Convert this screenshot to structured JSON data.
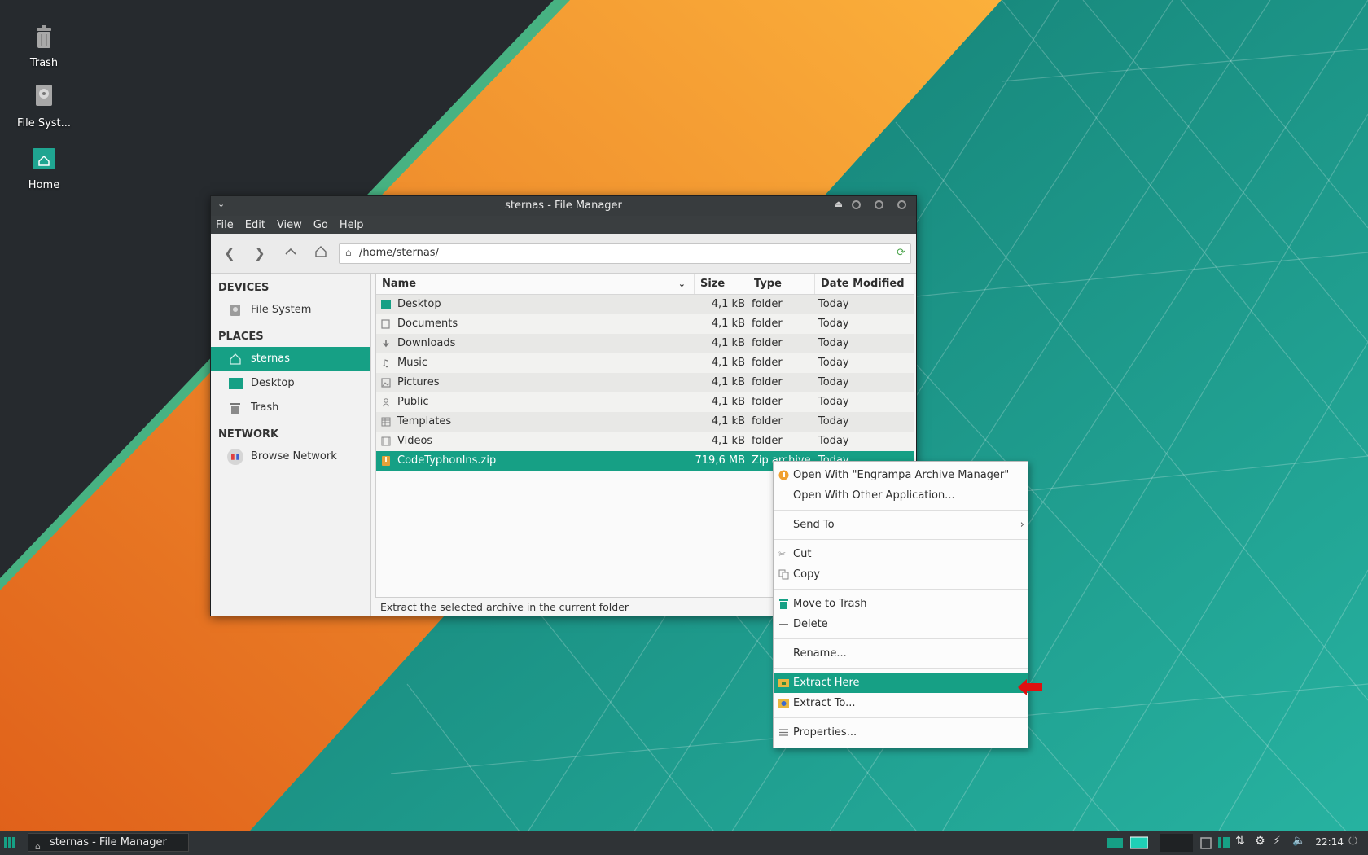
{
  "desktop": {
    "icons": [
      {
        "label": "Trash",
        "icon": "trash-icon"
      },
      {
        "label": "File Syst...",
        "icon": "drive-icon"
      },
      {
        "label": "Home",
        "icon": "home-folder-icon"
      }
    ]
  },
  "window": {
    "title": "sternas - File Manager",
    "menu": [
      "File",
      "Edit",
      "View",
      "Go",
      "Help"
    ],
    "address": "/home/sternas/"
  },
  "sidebar": {
    "devices_header": "DEVICES",
    "devices": [
      {
        "label": "File System",
        "icon": "drive-icon"
      }
    ],
    "places_header": "PLACES",
    "places": [
      {
        "label": "sternas",
        "icon": "home-icon",
        "selected": true
      },
      {
        "label": "Desktop",
        "icon": "desktop-folder-icon"
      },
      {
        "label": "Trash",
        "icon": "trash-icon"
      }
    ],
    "network_header": "NETWORK",
    "network": [
      {
        "label": "Browse Network",
        "icon": "network-icon"
      }
    ]
  },
  "list": {
    "columns": [
      "Name",
      "Size",
      "Type",
      "Date Modified"
    ],
    "rows": [
      {
        "name": "Desktop",
        "size": "4,1 kB",
        "type": "folder",
        "date": "Today",
        "icon": "desktop-folder-icon"
      },
      {
        "name": "Documents",
        "size": "4,1 kB",
        "type": "folder",
        "date": "Today",
        "icon": "documents-icon"
      },
      {
        "name": "Downloads",
        "size": "4,1 kB",
        "type": "folder",
        "date": "Today",
        "icon": "download-icon"
      },
      {
        "name": "Music",
        "size": "4,1 kB",
        "type": "folder",
        "date": "Today",
        "icon": "music-icon"
      },
      {
        "name": "Pictures",
        "size": "4,1 kB",
        "type": "folder",
        "date": "Today",
        "icon": "pictures-icon"
      },
      {
        "name": "Public",
        "size": "4,1 kB",
        "type": "folder",
        "date": "Today",
        "icon": "public-icon"
      },
      {
        "name": "Templates",
        "size": "4,1 kB",
        "type": "folder",
        "date": "Today",
        "icon": "templates-icon"
      },
      {
        "name": "Videos",
        "size": "4,1 kB",
        "type": "folder",
        "date": "Today",
        "icon": "videos-icon"
      },
      {
        "name": "CodeTyphonIns.zip",
        "size": "719,6 MB",
        "type": "Zip archive",
        "date": "Today",
        "icon": "archive-icon",
        "selected": true
      }
    ]
  },
  "status": "Extract the selected archive in the current folder",
  "context_menu": {
    "open_with": "Open With \"Engrampa Archive Manager\"",
    "open_other": "Open With Other Application...",
    "send_to": "Send To",
    "cut": "Cut",
    "copy": "Copy",
    "move_trash": "Move to Trash",
    "delete": "Delete",
    "rename": "Rename...",
    "extract_here": "Extract Here",
    "extract_to": "Extract To...",
    "properties": "Properties..."
  },
  "taskbar": {
    "task": "sternas - File Manager",
    "clock": "22:14"
  },
  "colors": {
    "accent": "#16a085",
    "orange": "#f08a24",
    "teal": "#1fa896",
    "panel": "#2f3336"
  }
}
